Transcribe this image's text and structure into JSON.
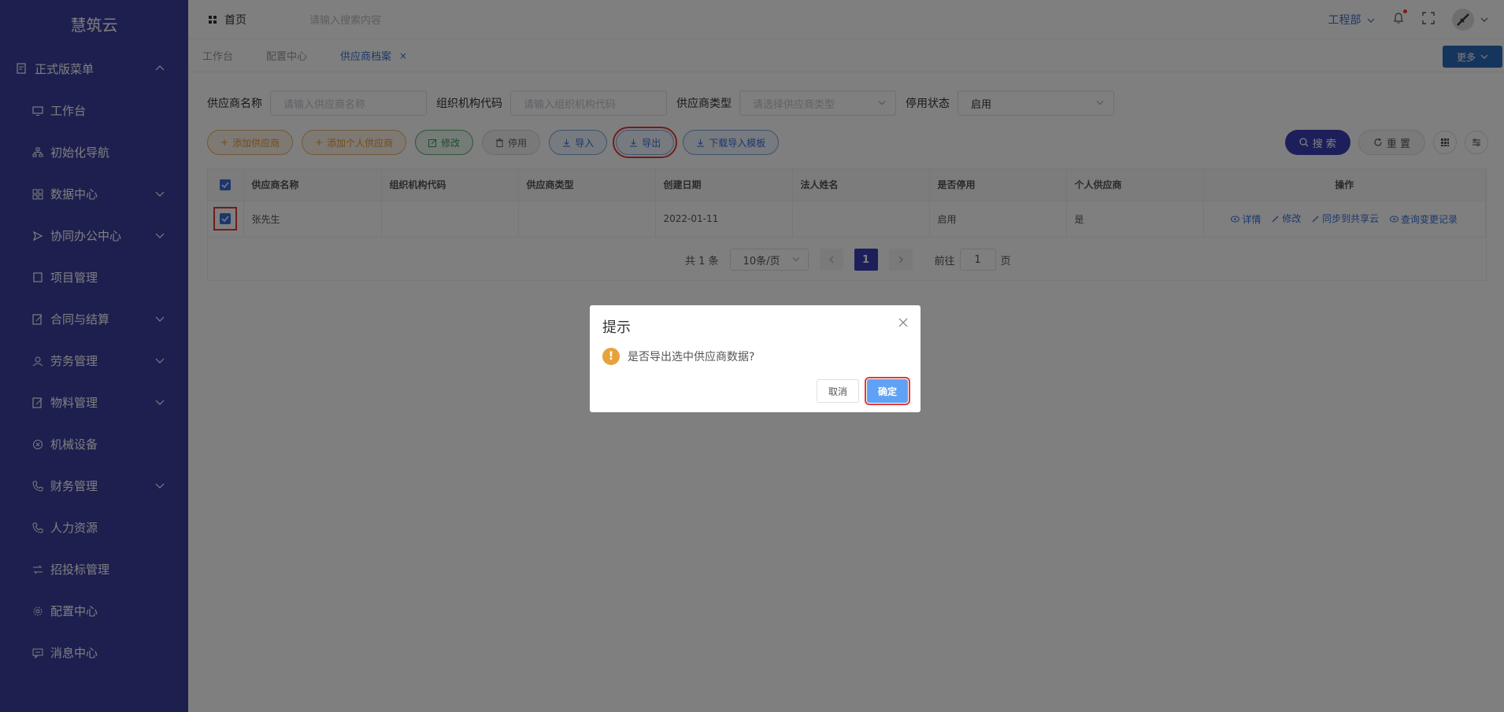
{
  "sidebar": {
    "logo": "慧筑云",
    "group": {
      "label": "正式版菜单",
      "icon": "menu-doc-icon"
    },
    "items": [
      {
        "label": "工作台",
        "icon": "monitor-icon",
        "has_children": false
      },
      {
        "label": "初始化导航",
        "icon": "sitemap-icon",
        "has_children": false
      },
      {
        "label": "数据中心",
        "icon": "grid-icon",
        "has_children": true
      },
      {
        "label": "协同办公中心",
        "icon": "send-icon",
        "has_children": true
      },
      {
        "label": "项目管理",
        "icon": "book-icon",
        "has_children": false
      },
      {
        "label": "合同与结算",
        "icon": "edit-doc-icon",
        "has_children": true
      },
      {
        "label": "劳务管理",
        "icon": "worker-icon",
        "has_children": true
      },
      {
        "label": "物料管理",
        "icon": "edit-doc-icon",
        "has_children": true
      },
      {
        "label": "机械设备",
        "icon": "circle-x-icon",
        "has_children": false
      },
      {
        "label": "财务管理",
        "icon": "phone-icon",
        "has_children": true
      },
      {
        "label": "人力资源",
        "icon": "phone-icon",
        "has_children": false
      },
      {
        "label": "招投标管理",
        "icon": "exchange-icon",
        "has_children": false
      },
      {
        "label": "配置中心",
        "icon": "gear-icon",
        "has_children": false
      },
      {
        "label": "消息中心",
        "icon": "message-icon",
        "has_children": false
      }
    ]
  },
  "topbar": {
    "home": "首页",
    "search_placeholder": "请输入搜索内容",
    "dept": "工程部"
  },
  "tabs": [
    {
      "label": "工作台",
      "active": false
    },
    {
      "label": "配置中心",
      "active": false
    },
    {
      "label": "供应商档案",
      "active": true
    }
  ],
  "more_label": "更多",
  "filters": {
    "supplier_name_label": "供应商名称",
    "supplier_name_placeholder": "请输入供应商名称",
    "org_code_label": "组织机构代码",
    "org_code_placeholder": "请输入组织机构代码",
    "supplier_type_label": "供应商类型",
    "supplier_type_placeholder": "请选择供应商类型",
    "status_label": "停用状态",
    "status_value": "启用"
  },
  "actions": {
    "add_supplier": "添加供应商",
    "add_personal": "添加个人供应商",
    "edit": "修改",
    "disable": "停用",
    "import": "导入",
    "export": "导出",
    "download_template": "下载导入模板",
    "search": "搜 索",
    "reset": "重 置"
  },
  "table": {
    "columns": [
      "供应商名称",
      "组织机构代码",
      "供应商类型",
      "创建日期",
      "法人姓名",
      "是否停用",
      "个人供应商",
      "操作"
    ],
    "rows": [
      {
        "name": "张先生",
        "org_code": "",
        "type": "",
        "date": "2022-01-11",
        "legal": "",
        "disabled": "启用",
        "personal": "是"
      }
    ],
    "ops": [
      "详情",
      "修改",
      "同步到共享云",
      "查询变更记录"
    ]
  },
  "pager": {
    "total": "共 1 条",
    "page_size": "10条/页",
    "current": "1",
    "goto_label": "前往",
    "goto_value": "1",
    "page_suffix": "页"
  },
  "dialog": {
    "title": "提示",
    "message": "是否导出选中供应商数据?",
    "cancel": "取消",
    "confirm": "确定"
  },
  "colors": {
    "sidebar_bg": "#3a3e9e",
    "primary": "#3a3eb5",
    "link": "#3a6fd8",
    "highlight": "#e53935"
  }
}
